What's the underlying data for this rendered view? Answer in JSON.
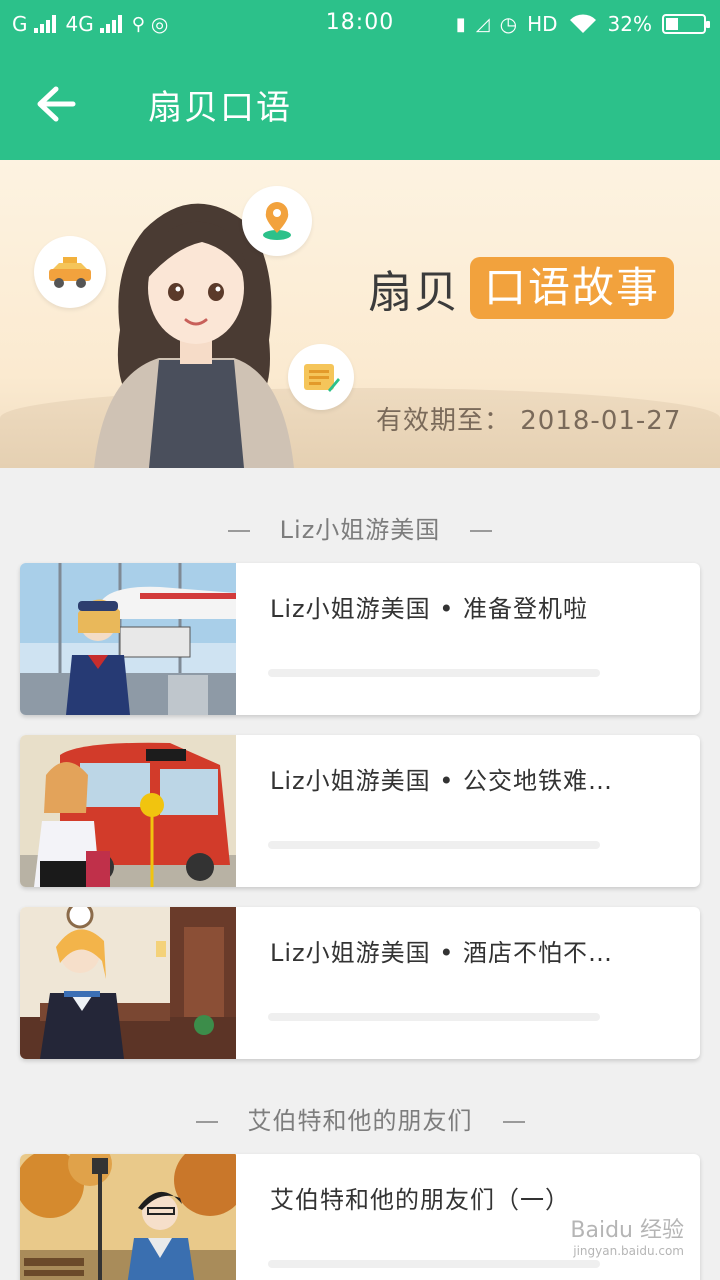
{
  "status_bar": {
    "carrier1": "G",
    "carrier2": "4G",
    "time": "18:00",
    "hd": "HD",
    "battery_text": "32%",
    "battery_level": 0.32
  },
  "toolbar": {
    "title": "扇贝口语",
    "back_icon": "arrow-left-icon"
  },
  "banner": {
    "brand_name": "扇贝",
    "brand_tag": "口语故事",
    "validity": "有效期至：  2018-01-27"
  },
  "sections": [
    {
      "title": "Liz小姐游美国",
      "items": [
        {
          "title": "Liz小姐游美国 • 准备登机啦",
          "progress": 0
        },
        {
          "title": "Liz小姐游美国 • 公交地铁难…",
          "progress": 0
        },
        {
          "title": "Liz小姐游美国 • 酒店不怕不…",
          "progress": 0
        }
      ]
    },
    {
      "title": "艾伯特和他的朋友们",
      "items": [
        {
          "title": "艾伯特和他的朋友们（一）",
          "progress": 0
        }
      ]
    }
  ],
  "watermark": {
    "brand": "Baidu 经验",
    "url": "jingyan.baidu.com"
  },
  "colors": {
    "primary": "#2cc18a",
    "accent": "#f2a23d"
  }
}
